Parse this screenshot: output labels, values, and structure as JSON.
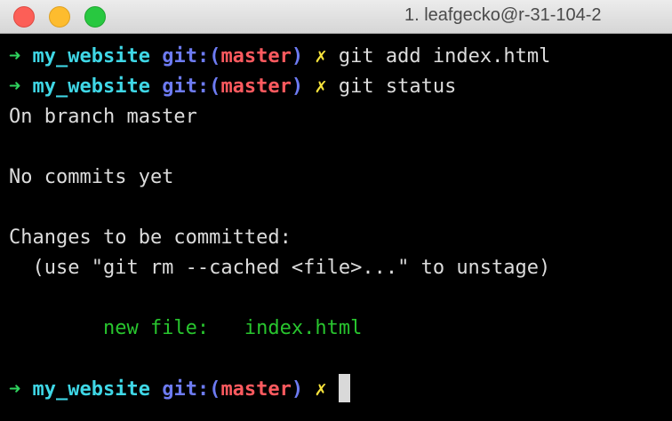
{
  "window": {
    "title": "1. leafgecko@r-31-104-2",
    "controls": {
      "close_icon": "close-icon",
      "minimize_icon": "minimize-icon",
      "zoom_icon": "zoom-icon"
    }
  },
  "prompt": {
    "arrow": "➜",
    "directory": "my_website",
    "git_prefix": "git:(",
    "branch": "master",
    "git_suffix": ")",
    "dirty_marker": "✗"
  },
  "commands": {
    "first": "git add index.html",
    "second": "git status"
  },
  "output": {
    "branch_line": "On branch master",
    "commits_line": "No commits yet",
    "changes_header": "Changes to be committed:",
    "unstage_hint": "  (use \"git rm --cached <file>...\" to unstage)",
    "new_file_label": "        new file:   ",
    "new_file_name": "index.html"
  },
  "colors": {
    "background": "#000000",
    "text": "#dcdcdc",
    "arrow": "#2fd35e",
    "directory": "#3fd7e6",
    "git": "#6d7bf2",
    "branch": "#ff5a5f",
    "dirty": "#f8e43c",
    "staged": "#28c52e"
  }
}
